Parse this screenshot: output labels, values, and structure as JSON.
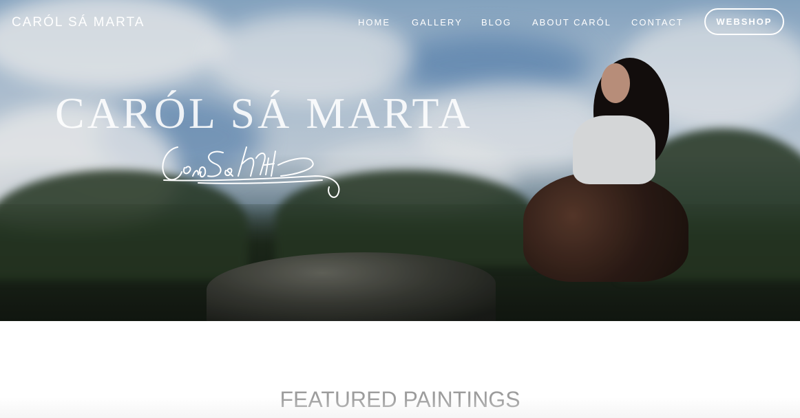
{
  "site": {
    "brand": "CARÓL SÁ MARTA"
  },
  "nav": {
    "items": [
      {
        "label": "HOME"
      },
      {
        "label": "GALLERY"
      },
      {
        "label": "BLOG"
      },
      {
        "label": "ABOUT CARÓL"
      },
      {
        "label": "CONTACT"
      }
    ],
    "webshop_label": "WEBSHOP"
  },
  "hero": {
    "title": "CARÓL SÁ MARTA",
    "signature_icon": "signature-image"
  },
  "featured": {
    "heading": "FEATURED PAINTINGS"
  },
  "colors": {
    "nav_text": "#ffffff",
    "heading_gray": "#9c9c9c"
  }
}
